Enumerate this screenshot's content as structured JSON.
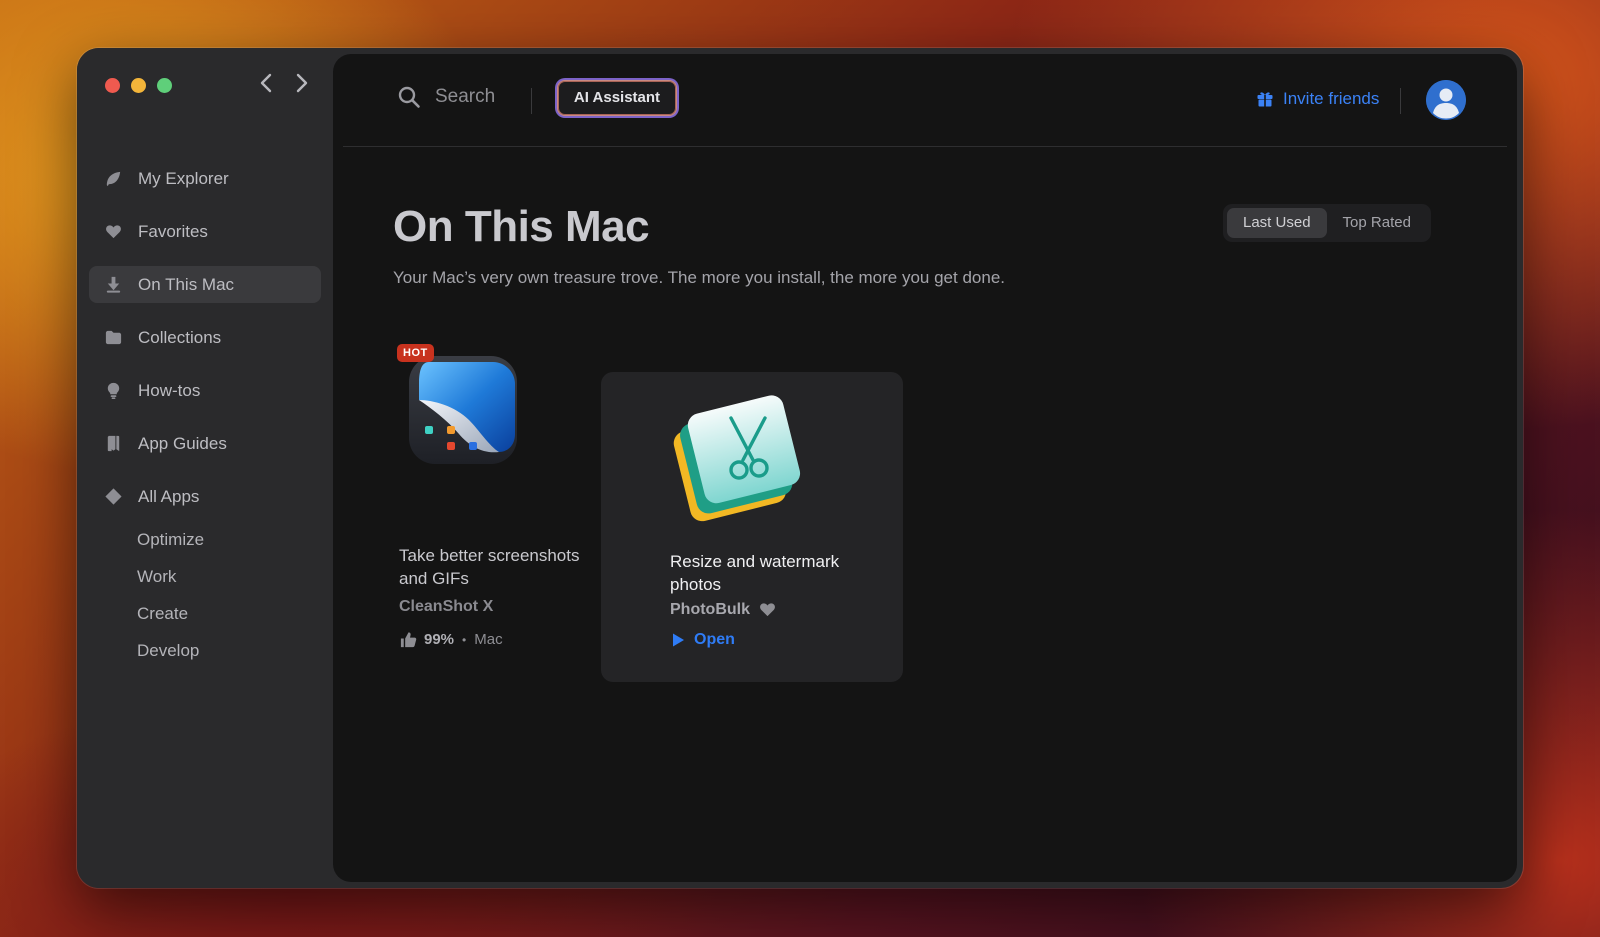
{
  "window": {
    "nav": {
      "back": "back",
      "forward": "forward"
    }
  },
  "sidebar": {
    "items": [
      {
        "label": "My Explorer",
        "icon": "leaf-icon"
      },
      {
        "label": "Favorites",
        "icon": "heart-icon"
      },
      {
        "label": "On This Mac",
        "icon": "download-arrow-icon",
        "active": true
      },
      {
        "label": "Collections",
        "icon": "folder-icon"
      },
      {
        "label": "How-tos",
        "icon": "lightbulb-icon"
      },
      {
        "label": "App Guides",
        "icon": "book-icon"
      },
      {
        "label": "All Apps",
        "icon": "diamond-icon"
      }
    ],
    "sub_items": [
      "Optimize",
      "Work",
      "Create",
      "Develop"
    ]
  },
  "topbar": {
    "search_label": "Search",
    "ai_button": "AI Assistant",
    "invite_label": "Invite friends"
  },
  "main": {
    "title": "On This Mac",
    "subtitle": "Your Mac’s very own treasure trove. The more you install, the more you get done.",
    "sort_options": [
      {
        "label": "Last Used",
        "active": true
      },
      {
        "label": "Top Rated",
        "active": false
      }
    ]
  },
  "apps": [
    {
      "badge": "HOT",
      "title": "Take better screenshots and GIFs",
      "name": "CleanShot X",
      "rating": "99%",
      "separator": "•",
      "platform": "Mac"
    },
    {
      "title": "Resize and watermark photos",
      "name": "PhotoBulk",
      "action": "Open"
    }
  ],
  "colors": {
    "accent_blue": "#2f7cf6",
    "hot_badge": "#c8321e",
    "sidebar_bg": "#2a2a2c",
    "content_bg": "#141414"
  }
}
